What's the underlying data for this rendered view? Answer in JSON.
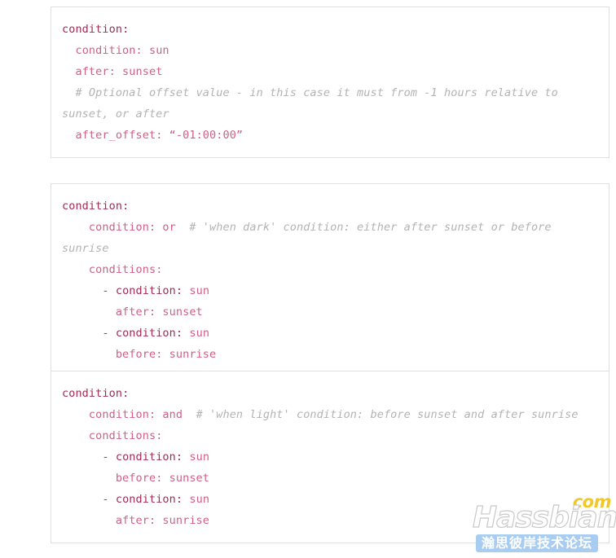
{
  "page": {
    "background_color": "#ffffff",
    "block_border_color": "#dfdfdf",
    "key_color": "#a12b54",
    "value_color": "#cf5f86",
    "comment_color": "#b3b3b3"
  },
  "blocks": [
    {
      "id": "block-1",
      "lines": [
        {
          "indent": 0,
          "text": "condition:"
        },
        {
          "indent": 1,
          "text": "condition: sun"
        },
        {
          "indent": 1,
          "text": "after: sunset"
        },
        {
          "indent": 1,
          "text": "# Optional offset value - in this case it must from -1 hours relative to sunset, or after",
          "comment": true
        },
        {
          "indent": 1,
          "text": "after_offset: “-01:00:00”"
        }
      ]
    },
    {
      "id": "block-2",
      "lines": [
        {
          "indent": 0,
          "text": "condition:"
        },
        {
          "indent": 2,
          "text": "condition: or",
          "trailing_comment": "# 'when dark' condition: either after sunset or before sunrise"
        },
        {
          "indent": 2,
          "text": "conditions:"
        },
        {
          "indent": 3,
          "text": "- condition: sun"
        },
        {
          "indent": 4,
          "text": "after: sunset"
        },
        {
          "indent": 3,
          "text": "- condition: sun"
        },
        {
          "indent": 4,
          "text": "before: sunrise"
        }
      ]
    },
    {
      "id": "block-3",
      "lines": [
        {
          "indent": 0,
          "text": "condition:"
        },
        {
          "indent": 2,
          "text": "condition: and",
          "trailing_comment": "# 'when light' condition: before sunset and after sunrise"
        },
        {
          "indent": 2,
          "text": "conditions:"
        },
        {
          "indent": 3,
          "text": "- condition: sun"
        },
        {
          "indent": 4,
          "text": "before: sunset"
        },
        {
          "indent": 3,
          "text": "- condition: sun"
        },
        {
          "indent": 4,
          "text": "after: sunrise"
        }
      ]
    }
  ],
  "watermark": {
    "com_text": "com",
    "main_text": "Hassbian",
    "band_text": "瀚思彼岸技术论坛"
  }
}
